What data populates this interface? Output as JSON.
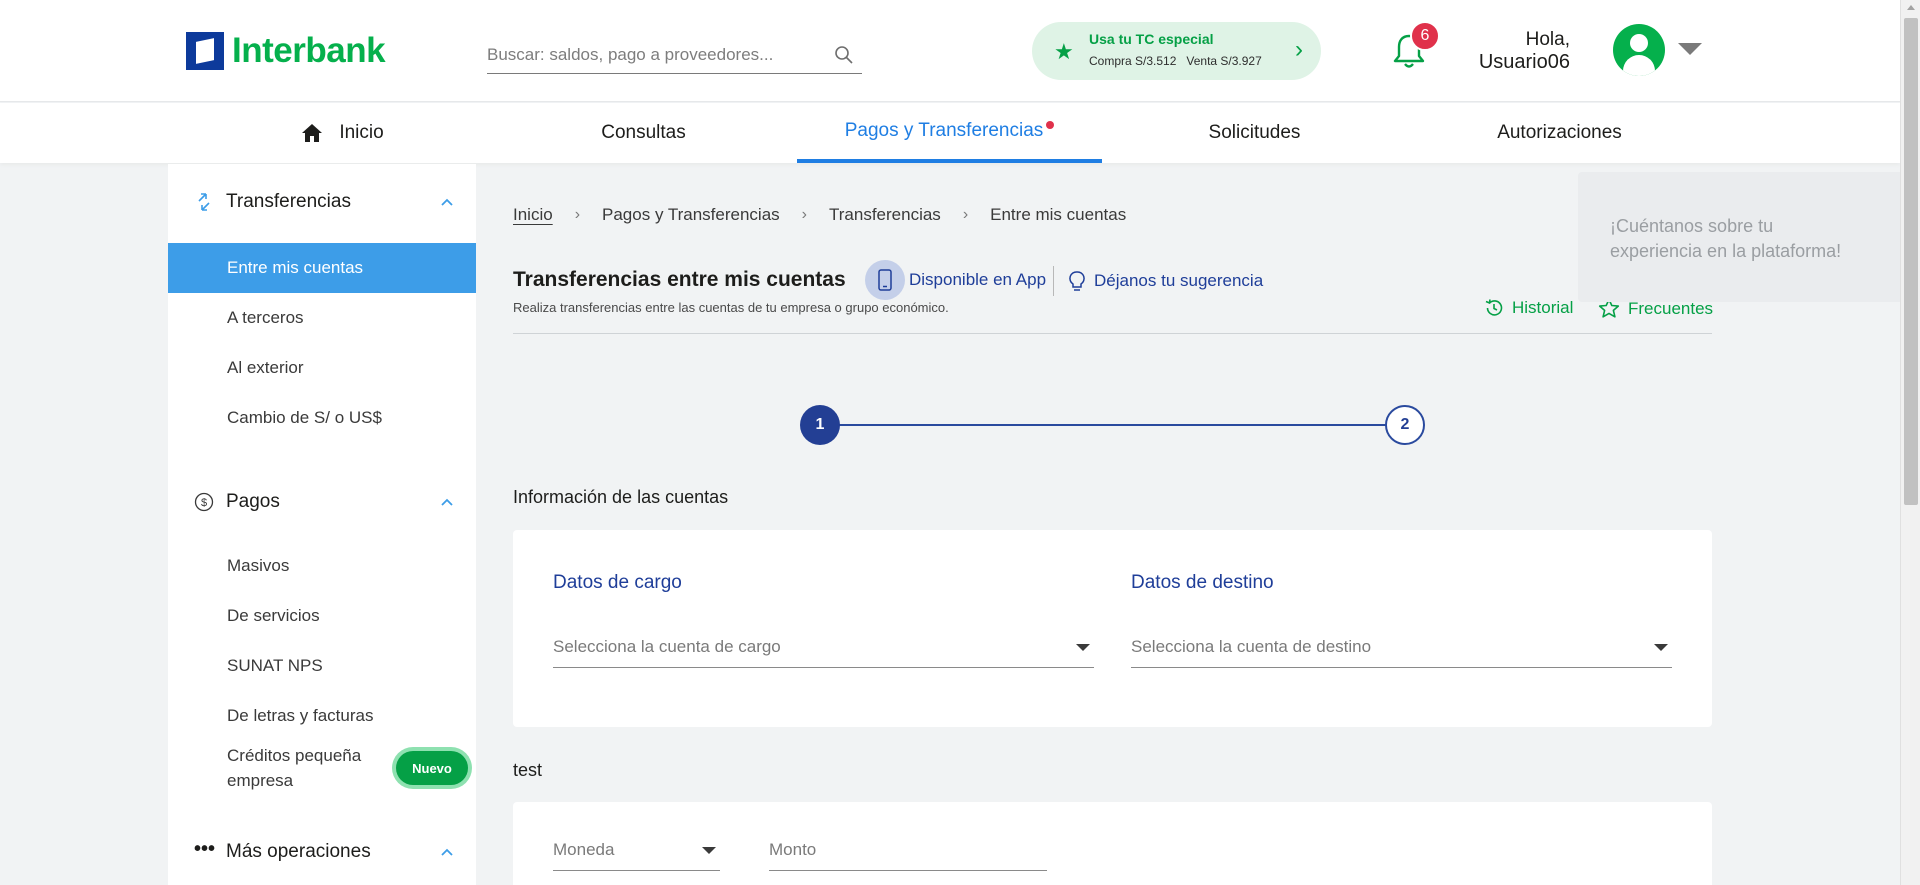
{
  "header": {
    "logo_text": "Interbank",
    "search_placeholder": "Buscar: saldos, pago a proveedores...",
    "tc": {
      "title": "Usa tu TC especial",
      "rates": "Compra S/3.512   Venta S/3.927"
    },
    "notifications_count": "6",
    "greeting": "Hola,",
    "username": "Usuario06"
  },
  "nav": {
    "items": [
      "Inicio",
      "Consultas",
      "Pagos y Transferencias",
      "Solicitudes",
      "Autorizaciones"
    ],
    "active_index": 2
  },
  "sidebar": {
    "transferencias": {
      "title": "Transferencias",
      "items": [
        "Entre mis cuentas",
        "A terceros",
        "Al exterior",
        "Cambio de S/ o US$"
      ]
    },
    "pagos": {
      "title": "Pagos",
      "items": [
        "Masivos",
        "De servicios",
        "SUNAT NPS",
        "De letras y facturas",
        "Créditos pequeña empresa"
      ],
      "badge": "Nuevo"
    },
    "mas": {
      "title": "Más operaciones"
    }
  },
  "breadcrumb": [
    "Inicio",
    "Pagos y Transferencias",
    "Transferencias",
    "Entre mis cuentas"
  ],
  "page": {
    "title": "Transferencias entre mis cuentas",
    "app_label": "Disponible en App",
    "suggest_label": "Déjanos tu sugerencia",
    "subtitle": "Realiza transferencias entre las cuentas de tu empresa o grupo económico.",
    "historial": "Historial",
    "frecuentes": "Frecuentes"
  },
  "stepper": {
    "steps": [
      "1",
      "2"
    ],
    "current": 1
  },
  "cuentas": {
    "section_title": "Información de las cuentas",
    "cargo_title": "Datos de cargo",
    "cargo_placeholder": "Selecciona la cuenta de cargo",
    "destino_title": "Datos de destino",
    "destino_placeholder": "Selecciona la cuenta de destino"
  },
  "monto_section": {
    "title": "test",
    "moneda_label": "Moneda",
    "monto_label": "Monto"
  },
  "feedback": {
    "text": "¡Cuéntanos sobre tu experiencia en la plataforma!"
  },
  "colors": {
    "brand_green": "#05b04c",
    "brand_blue": "#0d3a9b",
    "accent_blue": "#1f7ee3",
    "badge_red": "#e0314b"
  }
}
